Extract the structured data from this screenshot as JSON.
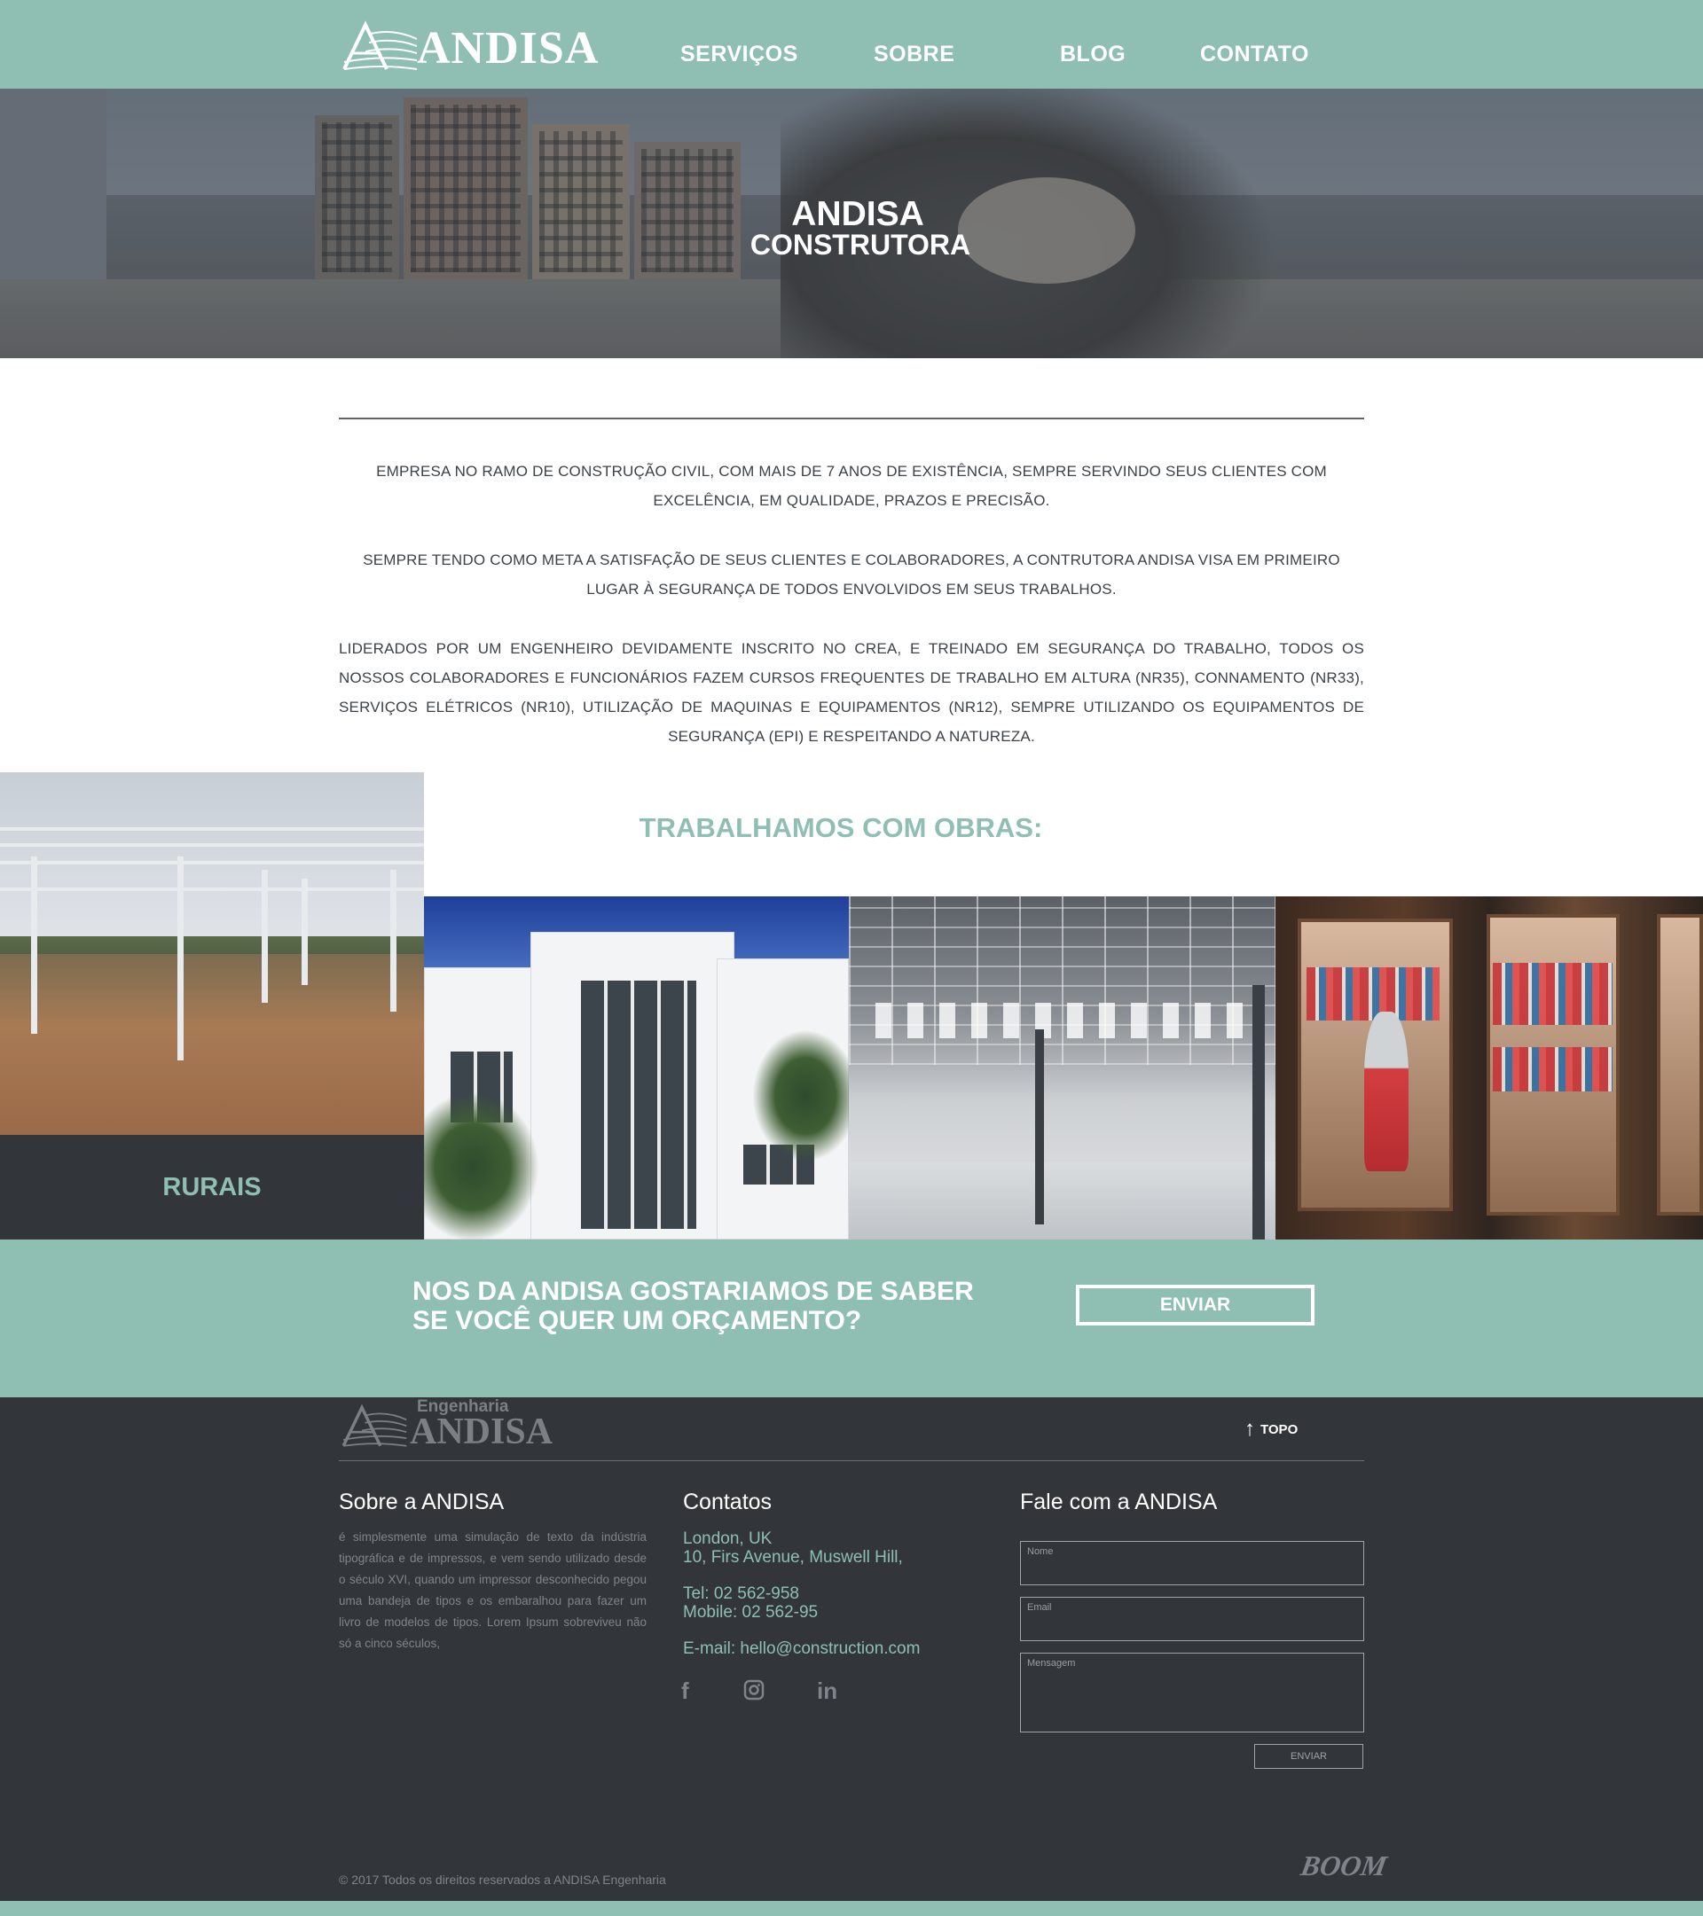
{
  "colors": {
    "accent": "#8fbfb3",
    "dark": "#32363b",
    "text": "#3d4247"
  },
  "brand": {
    "name": "ANDISA",
    "footer_prefix": "Engenharia"
  },
  "nav": {
    "items": [
      "SERVIÇOS",
      "SOBRE",
      "BLOG",
      "CONTATO"
    ]
  },
  "hero": {
    "title": "ANDISA",
    "subtitle": "CONSTRUTORA"
  },
  "about": {
    "paragraphs": [
      "EMPRESA NO RAMO DE CONSTRUÇÃO CIVIL, COM MAIS DE 7 ANOS DE EXISTÊNCIA, SEMPRE SERVINDO SEUS CLIENTES COM EXCELÊNCIA, EM QUALIDADE, PRAZOS E PRECISÃO.",
      "SEMPRE TENDO COMO META A SATISFAÇÃO DE SEUS CLIENTES E COLABORADORES, A CONTRUTORA ANDISA VISA EM PRIMEIRO LUGAR À SEGURANÇA DE TODOS ENVOLVIDOS EM SEUS TRABALHOS.",
      "LIDERADOS POR UM ENGENHEIRO DEVIDAMENTE INSCRITO NO CREA, E TREINADO EM SEGURANÇA DO TRABALHO, TODOS OS NOSSOS COLABORADORES E FUNCIONÁRIOS FAZEM CURSOS FREQUENTES DE TRABALHO EM ALTURA (NR35), CONNAMENTO (NR33), SERVIÇOS ELÉTRICOS (NR10), UTILIZAÇÃO DE MAQUINAS E EQUIPAMENTOS (NR12), SEMPRE UTILIZANDO OS EQUIPAMENTOS DE SEGURANÇA (EPI) E RESPEITANDO A NATUREZA."
    ]
  },
  "works": {
    "title": "TRABALHAMOS COM OBRAS:",
    "rural_label": "RURAIS"
  },
  "cta": {
    "line1": "NOS DA ANDISA GOSTARIAMOS  DE SABER",
    "line2": "SE VOCÊ QUER UM ORÇAMENTO?",
    "button": "ENVIAR"
  },
  "footer": {
    "topo": "TOPO",
    "sobre": {
      "title": "Sobre a ANDISA",
      "text": "é simplesmente uma simulação de texto da indústria tipográfica e de impressos, e vem sendo utilizado desde o século XVI, quando um impressor desconhecido pegou uma bandeja de tipos e os embaralhou para fazer um livro de modelos de tipos. Lorem Ipsum sobreviveu não só a cinco séculos,"
    },
    "contatos": {
      "title": "Contatos",
      "city": "London, UK",
      "address": "10, Firs Avenue, Muswell Hill,",
      "tel": "Tel: 02 562-958",
      "mobile": "Mobile: 02 562-95",
      "email": "E-mail: hello@construction.com"
    },
    "social": {
      "facebook": "f",
      "linkedin": "in"
    },
    "form": {
      "title": "Fale com a ANDISA",
      "name_placeholder": "Nome",
      "email_placeholder": "Email",
      "message_placeholder": "Mensagem",
      "send": "ENVIAR"
    },
    "copyright": "© 2017  Todos os direitos reservados a ANDISA Engenharia",
    "credit": "BOOM"
  }
}
